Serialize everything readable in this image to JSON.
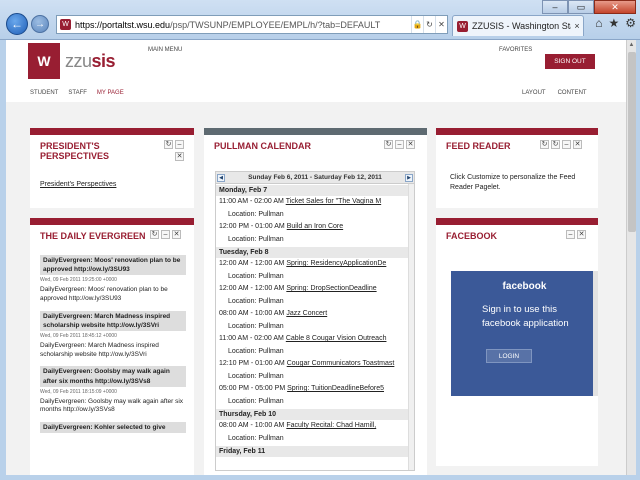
{
  "browser": {
    "url_host": "https://portaltst.wsu.edu",
    "url_path": "/psp/TWSUNP/EMPLOYEE/EMPL/h/?tab=DEFAULT",
    "tab_title": "ZZUSIS - Washington Stat...",
    "back_label": "←",
    "forward_label": "→",
    "lock_glyph": "🔒",
    "refresh_glyph": "↻",
    "stop_glyph": "✕",
    "tab_close": "×",
    "home_glyph": "⌂",
    "fav_glyph": "★",
    "settings_glyph": "⚙",
    "min_glyph": "–",
    "max_glyph": "▭",
    "close_glyph": "✕"
  },
  "header": {
    "main_menu": "MAIN MENU",
    "favorites": "FAVORITES",
    "logo_mark": "W",
    "logo_prefix": "zzu",
    "logo_suffix": "sis",
    "sign_out": "SIGN OUT",
    "nav": [
      "STUDENT",
      "STAFF",
      "MY PAGE"
    ],
    "right_nav": [
      "LAYOUT",
      "CONTENT"
    ]
  },
  "perspectives": {
    "title_line1": "PRESIDENT'S",
    "title_line2": "PERSPECTIVES",
    "link": "President's Perspectives"
  },
  "evergreen": {
    "title": "THE DAILY EVERGREEN",
    "items": [
      {
        "headline": "DailyEvergreen: Moos' renovation plan to be approved http://ow.ly/3SU93",
        "date": "Wed, 09 Feb 2011 19:25:00 +0000",
        "body": "DailyEvergreen: Moos' renovation plan to be approved http://ow.ly/3SU93"
      },
      {
        "headline": "DailyEvergreen: March Madness inspired scholarship website http://ow.ly/3SVri",
        "date": "Wed, 09 Feb 2011 18:45:12 +0000",
        "body": "DailyEvergreen: March Madness inspired scholarship website http://ow.ly/3SVri"
      },
      {
        "headline": "DailyEvergreen: Goolsby may walk again after six months http://ow.ly/3SVs8",
        "date": "Wed, 09 Feb 2011 18:15:09 +0000",
        "body": "DailyEvergreen: Goolsby may walk again after six months http://ow.ly/3SVs8"
      },
      {
        "headline": "DailyEvergreen: Kohler selected to give",
        "date": "",
        "body": ""
      }
    ]
  },
  "calendar": {
    "title": "PULLMAN CALENDAR",
    "range": "Sunday Feb 6, 2011 - Saturday Feb 12, 2011",
    "prev": "◀",
    "next": "▶",
    "days": [
      {
        "label": "Monday, Feb 7",
        "events": [
          {
            "time": "11:00 AM - 02:00 AM",
            "title": "Ticket Sales for \"The Vagina M",
            "location": "Location: Pullman"
          },
          {
            "time": "12:00 PM - 01:00 AM",
            "title": "Build an Iron Core",
            "location": "Location: Pullman"
          }
        ]
      },
      {
        "label": "Tuesday, Feb 8",
        "events": [
          {
            "time": "12:00 AM - 12:00 AM",
            "title": "Spring: ResidencyApplicationDe",
            "location": "Location: Pullman"
          },
          {
            "time": "12:00 AM - 12:00 AM",
            "title": "Spring: DropSectionDeadline",
            "location": "Location: Pullman"
          },
          {
            "time": "08:00 AM - 10:00 AM",
            "title": "Jazz Concert",
            "location": "Location: Pullman"
          },
          {
            "time": "11:00 AM - 02:00 AM",
            "title": "Cable 8 Cougar Vision Outreach",
            "location": "Location: Pullman"
          },
          {
            "time": "12:10 PM - 01:00 AM",
            "title": "Cougar Communicators Toastmast",
            "location": "Location: Pullman"
          },
          {
            "time": "05:00 PM - 05:00 PM",
            "title": "Spring: TuitionDeadlineBefore5",
            "location": "Location: Pullman"
          }
        ]
      },
      {
        "label": "Thursday, Feb 10",
        "events": [
          {
            "time": "08:00 AM - 10:00 AM",
            "title": "Faculty Recital: Chad Hamill,",
            "location": "Location: Pullman"
          }
        ]
      },
      {
        "label": "Friday, Feb 11",
        "events": []
      }
    ]
  },
  "feed": {
    "title": "FEED READER",
    "text": "Click Customize to personalize the Feed Reader Pagelet."
  },
  "facebook": {
    "title": "FACEBOOK",
    "brand": "facebook",
    "message": "Sign in to use this facebook application",
    "login": "LOGIN"
  },
  "pagelet_icons": {
    "refresh": "↻",
    "minimize": "–",
    "close": "✕"
  },
  "colors": {
    "brand": "#981e32",
    "calendar_bar": "#5e6a71",
    "facebook": "#3b5998"
  }
}
